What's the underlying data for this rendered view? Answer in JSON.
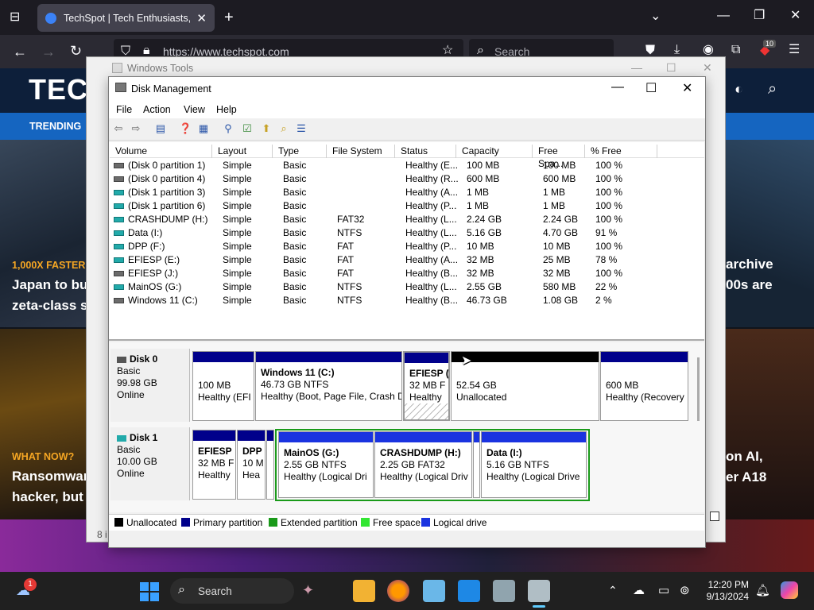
{
  "browser": {
    "tab_title": "TechSpot | Tech Enthusiasts, Po",
    "url": "https://www.techspot.com",
    "search_placeholder": "Search",
    "extension_badge": "10"
  },
  "site": {
    "logo": "TEC",
    "trending": "TRENDING",
    "story1_kicker": "1,000X FASTER",
    "story1_line1": "Japan to bu",
    "story1_line2": "zeta-class s",
    "story1_right1": "archive",
    "story1_right2": "00s are",
    "story2_kicker": "WHAT NOW?",
    "story2_line1": "Ransomwar",
    "story2_line2": "hacker, but c",
    "story2_right1": "on AI,",
    "story2_right2": "er A18"
  },
  "windows_tools": {
    "title": "Windows Tools",
    "status": "8 i"
  },
  "disk_management": {
    "title": "Disk Management",
    "menu": [
      "File",
      "Action",
      "View",
      "Help"
    ],
    "columns": [
      "Volume",
      "Layout",
      "Type",
      "File System",
      "Status",
      "Capacity",
      "Free Spa...",
      "% Free"
    ],
    "volumes": [
      {
        "volume": "(Disk 0 partition 1)",
        "layout": "Simple",
        "type": "Basic",
        "fs": "",
        "status": "Healthy (E...",
        "capacity": "100 MB",
        "free": "100 MB",
        "pct": "100 %",
        "icon": "gray"
      },
      {
        "volume": "(Disk 0 partition 4)",
        "layout": "Simple",
        "type": "Basic",
        "fs": "",
        "status": "Healthy (R...",
        "capacity": "600 MB",
        "free": "600 MB",
        "pct": "100 %",
        "icon": "gray"
      },
      {
        "volume": "(Disk 1 partition 3)",
        "layout": "Simple",
        "type": "Basic",
        "fs": "",
        "status": "Healthy (A...",
        "capacity": "1 MB",
        "free": "1 MB",
        "pct": "100 %",
        "icon": "teal"
      },
      {
        "volume": "(Disk 1 partition 6)",
        "layout": "Simple",
        "type": "Basic",
        "fs": "",
        "status": "Healthy (P...",
        "capacity": "1 MB",
        "free": "1 MB",
        "pct": "100 %",
        "icon": "teal"
      },
      {
        "volume": "CRASHDUMP (H:)",
        "layout": "Simple",
        "type": "Basic",
        "fs": "FAT32",
        "status": "Healthy (L...",
        "capacity": "2.24 GB",
        "free": "2.24 GB",
        "pct": "100 %",
        "icon": "teal"
      },
      {
        "volume": "Data (I:)",
        "layout": "Simple",
        "type": "Basic",
        "fs": "NTFS",
        "status": "Healthy (L...",
        "capacity": "5.16 GB",
        "free": "4.70 GB",
        "pct": "91 %",
        "icon": "teal"
      },
      {
        "volume": "DPP (F:)",
        "layout": "Simple",
        "type": "Basic",
        "fs": "FAT",
        "status": "Healthy (P...",
        "capacity": "10 MB",
        "free": "10 MB",
        "pct": "100 %",
        "icon": "teal"
      },
      {
        "volume": "EFIESP (E:)",
        "layout": "Simple",
        "type": "Basic",
        "fs": "FAT",
        "status": "Healthy (A...",
        "capacity": "32 MB",
        "free": "25 MB",
        "pct": "78 %",
        "icon": "teal"
      },
      {
        "volume": "EFIESP (J:)",
        "layout": "Simple",
        "type": "Basic",
        "fs": "FAT",
        "status": "Healthy (B...",
        "capacity": "32 MB",
        "free": "32 MB",
        "pct": "100 %",
        "icon": "gray"
      },
      {
        "volume": "MainOS (G:)",
        "layout": "Simple",
        "type": "Basic",
        "fs": "NTFS",
        "status": "Healthy (L...",
        "capacity": "2.55 GB",
        "free": "580 MB",
        "pct": "22 %",
        "icon": "teal"
      },
      {
        "volume": "Windows 11 (C:)",
        "layout": "Simple",
        "type": "Basic",
        "fs": "NTFS",
        "status": "Healthy (B...",
        "capacity": "46.73 GB",
        "free": "1.08 GB",
        "pct": "2 %",
        "icon": "gray"
      }
    ],
    "disks": [
      {
        "name": "Disk 0",
        "kind": "Basic",
        "size": "99.98 GB",
        "state": "Online",
        "partitions": [
          {
            "title": "",
            "line1": "100 MB",
            "line2": "Healthy (EFI"
          },
          {
            "title": "Windows 11  (C:)",
            "line1": "46.73 GB NTFS",
            "line2": "Healthy (Boot, Page File, Crash D"
          },
          {
            "title": "EFIESP  (",
            "line1": "32 MB F",
            "line2": "Healthy"
          },
          {
            "title": "",
            "line1": "52.54 GB",
            "line2": "Unallocated"
          },
          {
            "title": "",
            "line1": "600 MB",
            "line2": "Healthy (Recovery"
          }
        ]
      },
      {
        "name": "Disk 1",
        "kind": "Basic",
        "size": "10.00 GB",
        "state": "Online",
        "partitions": [
          {
            "title": "EFIESP",
            "line1": "32 MB F",
            "line2": "Healthy"
          },
          {
            "title": "DPP",
            "line1": "10 M",
            "line2": "Hea"
          },
          {
            "title": "MainOS  (G:)",
            "line1": "2.55 GB NTFS",
            "line2": "Healthy (Logical Dri"
          },
          {
            "title": "CRASHDUMP  (H:)",
            "line1": "2.25 GB FAT32",
            "line2": "Healthy (Logical Driv"
          },
          {
            "title": "Data  (I:)",
            "line1": "5.16 GB NTFS",
            "line2": "Healthy (Logical Drive"
          }
        ]
      }
    ],
    "legend": [
      {
        "label": "Unallocated",
        "color": "#000000"
      },
      {
        "label": "Primary partition",
        "color": "#00008b"
      },
      {
        "label": "Extended partition",
        "color": "#1a9a1a"
      },
      {
        "label": "Free space",
        "color": "#33e633"
      },
      {
        "label": "Logical drive",
        "color": "#1a33e0"
      }
    ]
  },
  "taskbar": {
    "weather_badge": "1",
    "search_label": "Search",
    "time": "12:20 PM",
    "date": "9/13/2024"
  }
}
